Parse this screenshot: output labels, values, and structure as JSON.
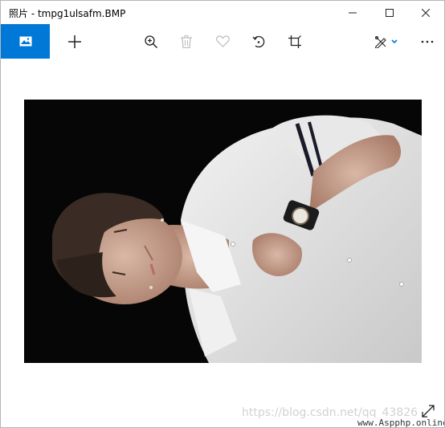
{
  "window": {
    "title": "照片 - tmpg1ulsafm.BMP",
    "controls": {
      "minimize": "minimize-icon",
      "maximize": "maximize-icon",
      "close": "close-icon"
    }
  },
  "toolbar": {
    "app_icon": "photos-app-icon",
    "accent_color": "#0078d7",
    "buttons": [
      {
        "name": "add",
        "icon": "plus-icon",
        "enabled": true
      },
      {
        "name": "zoom",
        "icon": "zoom-in-icon",
        "enabled": true
      },
      {
        "name": "delete",
        "icon": "trash-icon",
        "enabled": false
      },
      {
        "name": "favorite",
        "icon": "heart-icon",
        "enabled": false
      },
      {
        "name": "rotate",
        "icon": "rotate-icon",
        "enabled": true
      },
      {
        "name": "crop",
        "icon": "crop-icon",
        "enabled": true
      },
      {
        "name": "edit-create",
        "icon": "edit-create-icon",
        "enabled": true
      },
      {
        "name": "more",
        "icon": "more-icon",
        "enabled": true
      }
    ]
  },
  "viewer": {
    "image_subject": "photo-of-person-in-white-shirt",
    "watermark": "https://blog.csdn.net/qq_43826",
    "site_mark": "www.Aspphp.online",
    "fullscreen_icon": "expand-icon"
  }
}
